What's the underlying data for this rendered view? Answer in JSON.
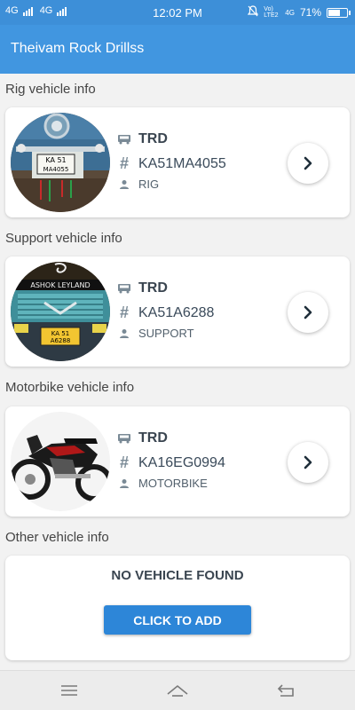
{
  "status_bar": {
    "left_text_1": "4G",
    "left_text_2": "4G",
    "time": "12:02 PM",
    "right_text_1": "Vo) LTE2",
    "right_text_2": "4G",
    "battery": "71%",
    "battery_level": 0.71
  },
  "app_bar": {
    "title": "Theivam Rock Drillss"
  },
  "sections": [
    {
      "label": "Rig vehicle info",
      "owner": "TRD",
      "number": "KA51MA4055",
      "type": "RIG",
      "photo_icon": "truck-front-photo",
      "plate": [
        "KA 51",
        "MA4055"
      ]
    },
    {
      "label": "Support vehicle info",
      "owner": "TRD",
      "number": "KA51A6288",
      "type": "SUPPORT",
      "photo_icon": "ashok-leyland-truck-photo",
      "brand": "ASHOK LEYLAND",
      "plate": [
        "KA 51",
        "A6288"
      ]
    },
    {
      "label": "Motorbike vehicle info",
      "owner": "TRD",
      "number": "KA16EG0994",
      "type": "MOTORBIKE",
      "photo_icon": "motorbike-photo"
    }
  ],
  "other": {
    "label": "Other vehicle info",
    "empty_text": "NO VEHICLE FOUND",
    "button_label": "CLICK TO ADD"
  },
  "icons": {
    "owner": "truck-icon",
    "number": "hash-icon",
    "type": "person-icon",
    "open": "chevron-right-icon"
  },
  "colors": {
    "app_bar": "#4196e0",
    "status_bar": "#3d8fd8",
    "button": "#2d86d8"
  }
}
